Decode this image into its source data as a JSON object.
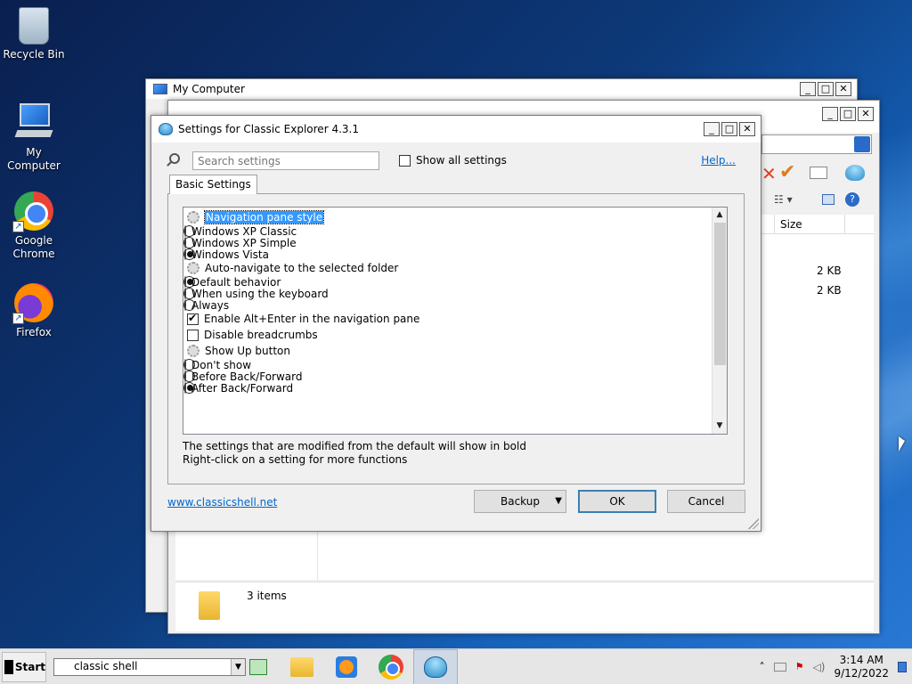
{
  "desktop": {
    "icons": [
      {
        "label": "Recycle Bin",
        "icon": "recycle-bin-icon"
      },
      {
        "label": "My Computer",
        "icon": "computer-icon"
      },
      {
        "label": "Google Chrome",
        "icon": "chrome-icon"
      },
      {
        "label": "Firefox",
        "icon": "firefox-icon"
      }
    ]
  },
  "bg_window": {
    "title": "My Computer",
    "size_header": "Size",
    "sizes": [
      "2 KB",
      "2 KB"
    ],
    "status": "3 items"
  },
  "dialog": {
    "title": "Settings for Classic Explorer 4.3.1",
    "search_placeholder": "Search settings",
    "show_all_label": "Show all settings",
    "help_label": "Help...",
    "tab_label": "Basic Settings",
    "settings": [
      {
        "kind": "group",
        "label": "Navigation pane style",
        "selected": true
      },
      {
        "kind": "radio",
        "label": "Windows XP Classic",
        "checked": false
      },
      {
        "kind": "radio",
        "label": "Windows XP Simple",
        "checked": false
      },
      {
        "kind": "radio",
        "label": "Windows Vista",
        "checked": true
      },
      {
        "kind": "group",
        "label": "Auto-navigate to the selected folder",
        "selected": false
      },
      {
        "kind": "radio",
        "label": "Default behavior",
        "checked": true
      },
      {
        "kind": "radio",
        "label": "When using the keyboard",
        "checked": false
      },
      {
        "kind": "radio",
        "label": "Always",
        "checked": false
      },
      {
        "kind": "check",
        "label": "Enable Alt+Enter in the navigation pane",
        "checked": true
      },
      {
        "kind": "check",
        "label": "Disable breadcrumbs",
        "checked": false
      },
      {
        "kind": "group",
        "label": "Show Up button",
        "selected": false
      },
      {
        "kind": "radio",
        "label": "Don't show",
        "checked": false
      },
      {
        "kind": "radio",
        "label": "Before Back/Forward",
        "checked": false
      },
      {
        "kind": "radio",
        "label": "After Back/Forward",
        "checked": true
      }
    ],
    "note_line1": "The settings that are modified from the default will show in bold",
    "note_line2": "Right-click on a setting for more functions",
    "site_link": "www.classicshell.net",
    "backup_label": "Backup",
    "ok_label": "OK",
    "cancel_label": "Cancel"
  },
  "taskbar": {
    "start_label": "Start",
    "search_value": "classic shell",
    "apps": [
      "file-explorer-icon",
      "media-player-icon",
      "chrome-icon",
      "classic-shell-icon"
    ],
    "clock_time": "3:14 AM",
    "clock_date": "9/12/2022"
  }
}
